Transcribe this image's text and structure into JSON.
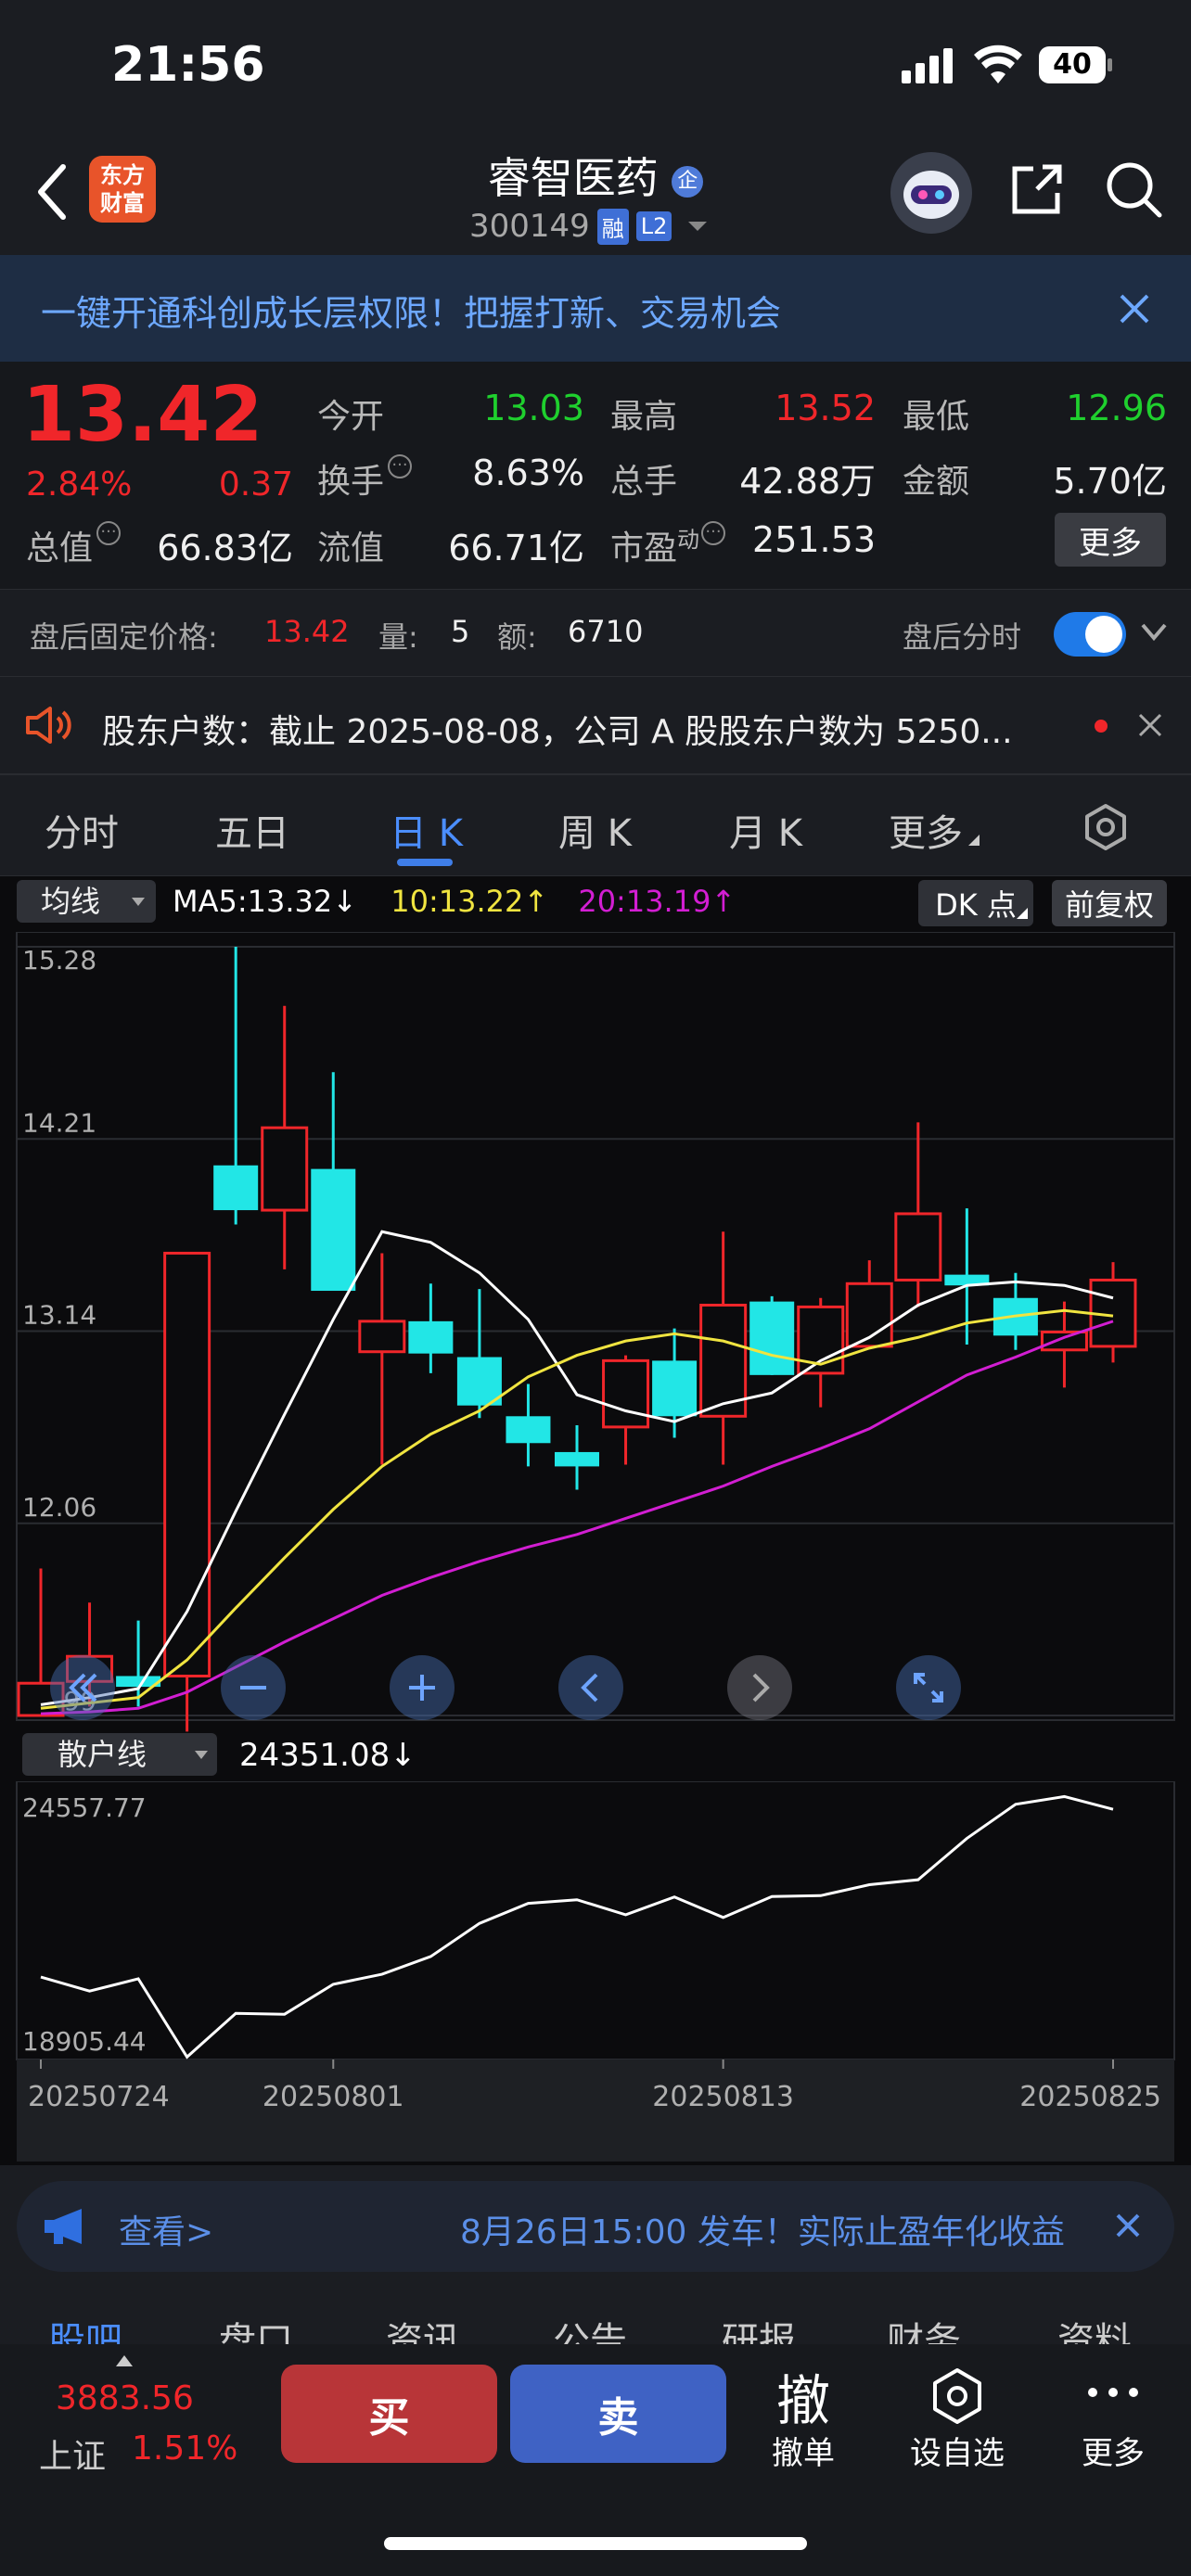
{
  "status": {
    "time": "21:56",
    "battery": "40"
  },
  "header": {
    "logo_line1": "东方",
    "logo_line2": "财富",
    "stock_name": "睿智医药",
    "badge_q": "企",
    "code": "300149",
    "tag_rong": "融",
    "tag_l2": "L2"
  },
  "banner": {
    "text": "一键开通科创成长层权限！把握打新、交易机会"
  },
  "quote": {
    "price": "13.42",
    "pct": "2.84%",
    "chg": "0.37",
    "open_label": "今开",
    "open": "13.03",
    "high_label": "最高",
    "high": "13.52",
    "low_label": "最低",
    "low": "12.96",
    "turnover_label": "换手",
    "turnover": "8.63%",
    "volume_label": "总手",
    "volume": "42.88万",
    "amount_label": "金额",
    "amount": "5.70亿",
    "totalcap_label": "总值",
    "totalcap": "66.83亿",
    "floatcap_label": "流值",
    "floatcap": "66.71亿",
    "pe_label": "市盈",
    "pe_sup": "动",
    "pe": "251.53",
    "more": "更多"
  },
  "after": {
    "label": "盘后固定价格:",
    "price": "13.42",
    "vol_label": "量:",
    "vol": "5",
    "amt_label": "额:",
    "amt": "6710",
    "toggle_label": "盘后分时"
  },
  "notice": {
    "text": "股东户数：截止 2025-08-08，公司 A 股股东户数为 5250..."
  },
  "tabs": [
    {
      "label": "分时"
    },
    {
      "label": "五日"
    },
    {
      "label": "日 K"
    },
    {
      "label": "周 K"
    },
    {
      "label": "月 K"
    },
    {
      "label": "更多"
    }
  ],
  "legend": {
    "select": "均线",
    "ma5": "MA5:13.32",
    "ma5_arrow": "↓",
    "ma10": "10:13.22",
    "ma10_arrow": "↑",
    "ma20": "20:13.19",
    "ma20_arrow": "↑",
    "dk": "DK 点",
    "fq": "前复权"
  },
  "colors": {
    "up": "#f0262a",
    "down": "#22e6e6",
    "ma5": "#ffffff",
    "ma10": "#f0e440",
    "ma20": "#d21ed2"
  },
  "chart_data": [
    {
      "type": "candlestick",
      "yticks": [
        "15.28",
        "14.21",
        "13.14",
        "12.06",
        "10.99"
      ],
      "ylim": [
        10.99,
        15.28
      ],
      "candles": [
        {
          "o": 10.99,
          "c": 11.17,
          "h": 11.81,
          "l": 10.99,
          "dir": "up"
        },
        {
          "o": 11.18,
          "c": 11.32,
          "h": 11.62,
          "l": 11.04,
          "dir": "up"
        },
        {
          "o": 11.21,
          "c": 11.15,
          "h": 11.52,
          "l": 11.04,
          "dir": "down"
        },
        {
          "o": 11.21,
          "c": 13.57,
          "h": 13.57,
          "l": 10.9,
          "dir": "up"
        },
        {
          "o": 14.06,
          "c": 13.81,
          "h": 15.28,
          "l": 13.73,
          "dir": "down"
        },
        {
          "o": 13.81,
          "c": 14.27,
          "h": 14.95,
          "l": 13.48,
          "dir": "up"
        },
        {
          "o": 14.04,
          "c": 13.36,
          "h": 14.58,
          "l": 13.36,
          "dir": "down"
        },
        {
          "o": 13.02,
          "c": 13.19,
          "h": 13.57,
          "l": 12.39,
          "dir": "up"
        },
        {
          "o": 13.19,
          "c": 13.01,
          "h": 13.4,
          "l": 12.9,
          "dir": "down"
        },
        {
          "o": 12.99,
          "c": 12.72,
          "h": 13.37,
          "l": 12.65,
          "dir": "down"
        },
        {
          "o": 12.66,
          "c": 12.51,
          "h": 12.84,
          "l": 12.38,
          "dir": "down"
        },
        {
          "o": 12.46,
          "c": 12.38,
          "h": 12.61,
          "l": 12.25,
          "dir": "down"
        },
        {
          "o": 12.6,
          "c": 12.97,
          "h": 13.0,
          "l": 12.39,
          "dir": "up"
        },
        {
          "o": 12.97,
          "c": 12.66,
          "h": 13.15,
          "l": 12.54,
          "dir": "down"
        },
        {
          "o": 12.66,
          "c": 13.28,
          "h": 13.69,
          "l": 12.39,
          "dir": "up"
        },
        {
          "o": 13.3,
          "c": 12.89,
          "h": 13.33,
          "l": 12.89,
          "dir": "down"
        },
        {
          "o": 12.9,
          "c": 13.27,
          "h": 13.32,
          "l": 12.71,
          "dir": "up"
        },
        {
          "o": 13.05,
          "c": 13.4,
          "h": 13.53,
          "l": 13.05,
          "dir": "up"
        },
        {
          "o": 13.42,
          "c": 13.79,
          "h": 14.3,
          "l": 13.27,
          "dir": "up"
        },
        {
          "o": 13.45,
          "c": 13.39,
          "h": 13.82,
          "l": 13.06,
          "dir": "down"
        },
        {
          "o": 13.32,
          "c": 13.11,
          "h": 13.46,
          "l": 13.03,
          "dir": "down"
        },
        {
          "o": 13.03,
          "c": 13.13,
          "h": 13.3,
          "l": 12.82,
          "dir": "up"
        },
        {
          "o": 13.05,
          "c": 13.42,
          "h": 13.52,
          "l": 12.96,
          "dir": "up"
        }
      ],
      "ma5": [
        11.05,
        11.09,
        11.14,
        11.57,
        12.13,
        12.67,
        13.2,
        13.69,
        13.63,
        13.46,
        13.2,
        12.78,
        12.69,
        12.63,
        12.73,
        12.79,
        12.97,
        13.1,
        13.28,
        13.39,
        13.41,
        13.39,
        13.32
      ],
      "ma10": [
        11.03,
        11.06,
        11.09,
        11.3,
        11.59,
        11.87,
        12.14,
        12.38,
        12.56,
        12.69,
        12.88,
        13.0,
        13.08,
        13.12,
        13.08,
        13.0,
        12.95,
        13.04,
        13.1,
        13.18,
        13.22,
        13.25,
        13.22
      ],
      "ma20": [
        11.0,
        11.01,
        11.03,
        11.12,
        11.26,
        11.4,
        11.53,
        11.66,
        11.76,
        11.85,
        11.93,
        12.0,
        12.09,
        12.18,
        12.27,
        12.38,
        12.48,
        12.59,
        12.74,
        12.89,
        12.99,
        13.1,
        13.19
      ]
    },
    {
      "type": "line",
      "name": "散户线",
      "value_label": "24351.08",
      "arrow": "↓",
      "yticks": [
        "24557.77",
        "18905.44"
      ],
      "ylim": [
        18905.44,
        24557.77
      ],
      "values": [
        20660,
        20350,
        20620,
        18900,
        19860,
        19840,
        20500,
        20720,
        21110,
        21840,
        22280,
        22360,
        22030,
        22420,
        21970,
        22430,
        22450,
        22690,
        22800,
        23710,
        24460,
        24630,
        24350
      ],
      "xticks": [
        {
          "i": 0,
          "label": "20250724"
        },
        {
          "i": 6,
          "label": "20250801"
        },
        {
          "i": 14,
          "label": "20250813"
        },
        {
          "i": 22,
          "label": "20250825"
        }
      ]
    }
  ],
  "ad": {
    "left": "查看>",
    "text": "8月26日15:00 发车！实际止盈年化收益"
  },
  "subtabs": [
    "股吧",
    "盘口",
    "资讯",
    "公告",
    "研报",
    "财务",
    "资料"
  ],
  "bottom": {
    "index_value": "3883.56",
    "index_name": "上证",
    "index_pct": "1.51%",
    "buy": "买",
    "sell": "卖",
    "cancel_big": "撤",
    "cancel": "撤单",
    "watch": "设自选",
    "more": "更多"
  }
}
